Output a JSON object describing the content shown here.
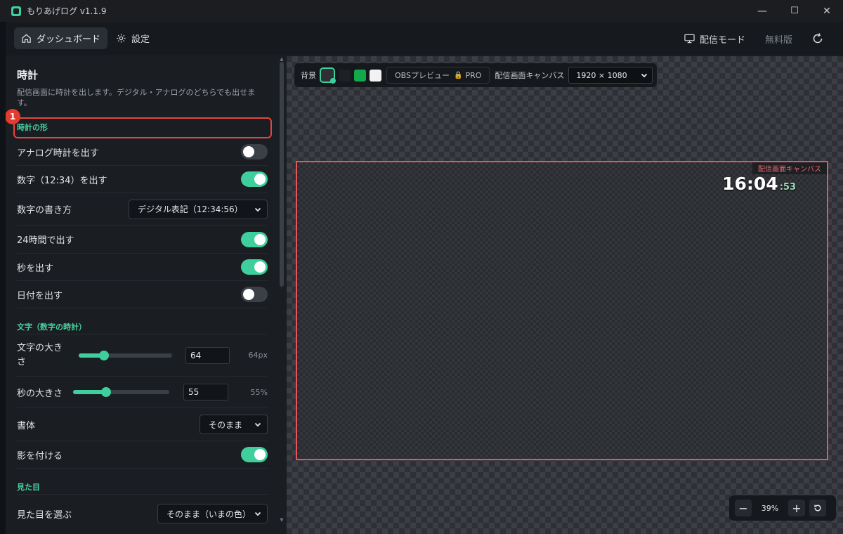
{
  "app": {
    "title": "もりあげログ  v1.1.9"
  },
  "window_controls": {
    "minimize": "—",
    "maximize": "☐",
    "close": "✕"
  },
  "header": {
    "nav": [
      {
        "label": "ダッシュボード",
        "icon": "home-icon",
        "active": true
      },
      {
        "label": "設定",
        "icon": "gear-icon",
        "active": false
      }
    ],
    "stream_mode": "配信モード",
    "plan": "無料版"
  },
  "sidebar": {
    "title": "時計",
    "description": "配信画面に時計を出します。デジタル・アナログのどちらでも出せます。",
    "annotation_badge": "1",
    "sections": {
      "shape": "時計の形",
      "text": "文字（数字の時計）",
      "appearance": "見た目"
    },
    "rows": {
      "analog": {
        "label": "アナログ時計を出す",
        "on": false
      },
      "digits": {
        "label": "数字（12:34）を出す",
        "on": true
      },
      "format": {
        "label": "数字の書き方",
        "value": "デジタル表記（12:34:56）"
      },
      "hour24": {
        "label": "24時間で出す",
        "on": true
      },
      "seconds": {
        "label": "秒を出す",
        "on": true
      },
      "date": {
        "label": "日付を出す",
        "on": false
      },
      "text_size": {
        "label": "文字の大きさ",
        "value": "64",
        "unit": "64px",
        "fraction": 0.27
      },
      "sec_size": {
        "label": "秒の大きさ",
        "value": "55",
        "unit": "55%",
        "fraction": 0.34
      },
      "font": {
        "label": "書体",
        "value": "そのまま"
      },
      "shadow": {
        "label": "影を付ける",
        "on": true
      },
      "look": {
        "label": "見た目を選ぶ",
        "value": "そのまま（いまの色）"
      }
    }
  },
  "preview": {
    "bg_label": "背景",
    "swatch_colors": [
      "#1e2024",
      "#13a94a",
      "#f2f2f2"
    ],
    "obs_label": "OBSプレビュー",
    "pro_label": "PRO",
    "canvas_label_text": "配信画面キャンバス",
    "resolution": "1920 × 1080",
    "canvas_tag": "配信画面キャンバス",
    "clock_time": "16:04",
    "clock_seconds": ":53",
    "zoom": "39%"
  },
  "colors": {
    "accent": "#3fcf9c",
    "highlight": "#e8453c",
    "canvas_border": "#e5555a"
  }
}
